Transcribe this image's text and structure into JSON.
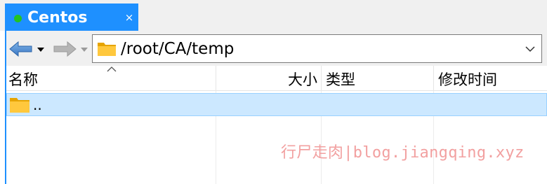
{
  "tab": {
    "title": "Centos",
    "close_glyph": "×",
    "status_color": "#22c322"
  },
  "toolbar": {
    "back_icon": "arrow-left-icon",
    "forward_icon": "arrow-right-icon",
    "address_path": "/root/CA/temp",
    "address_icon": "folder-icon"
  },
  "columns": {
    "name": "名称",
    "size": "大小",
    "type": "类型",
    "modified": "修改时间"
  },
  "rows": [
    {
      "name": "..",
      "size": "",
      "type": "",
      "modified": "",
      "icon": "folder-icon"
    }
  ],
  "watermark": "行尸走肉|blog.jiangqing.xyz",
  "colors": {
    "accent": "#1e90ff",
    "selection": "#cce8ff",
    "selection_border": "#99d1ff",
    "folder": "#ffc83d"
  }
}
